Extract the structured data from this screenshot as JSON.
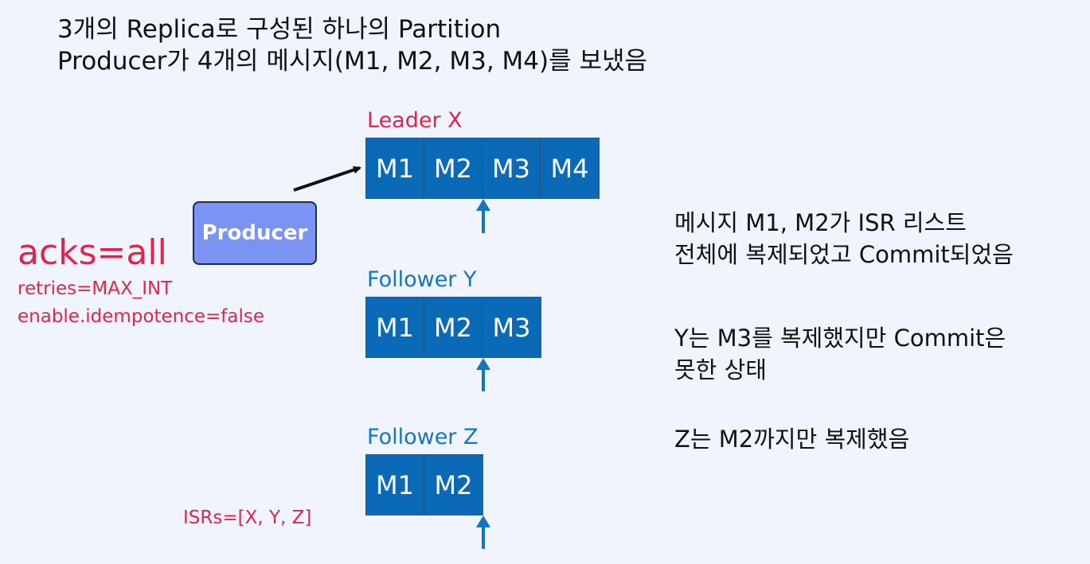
{
  "title": {
    "line1": "3개의 Replica로 구성된 하나의 Partition",
    "line2": "Producer가 4개의 메시지(M1, M2, M3, M4)를 보냈음"
  },
  "producer": {
    "label": "Producer"
  },
  "config": {
    "acks": "acks=all",
    "retries": "retries=MAX_INT",
    "idempotence": "enable.idempotence=false",
    "isrs": "ISRs=[X, Y, Z]"
  },
  "replicas": {
    "leader": {
      "label": "Leader X",
      "messages": [
        "M1",
        "M2",
        "M3",
        "M4"
      ]
    },
    "follower_y": {
      "label": "Follower Y",
      "messages": [
        "M1",
        "M2",
        "M3"
      ]
    },
    "follower_z": {
      "label": "Follower Z",
      "messages": [
        "M1",
        "M2"
      ]
    }
  },
  "notes": {
    "leader": {
      "line1": "메시지 M1, M2가 ISR 리스트",
      "line2": "전체에 복제되었고 Commit되었음"
    },
    "follower_y": {
      "line1": "Y는 M3를 복제했지만 Commit은",
      "line2": "못한 상태"
    },
    "follower_z": {
      "line1": "Z는 M2까지만 복제했음"
    }
  },
  "colors": {
    "cell": "#0a6ab8",
    "leader_label": "#e5224b",
    "follower_label": "#1277c0",
    "config_text": "#e5224b",
    "producer_fill": "#7b93f2",
    "pointer_arrow": "#1277c0"
  }
}
